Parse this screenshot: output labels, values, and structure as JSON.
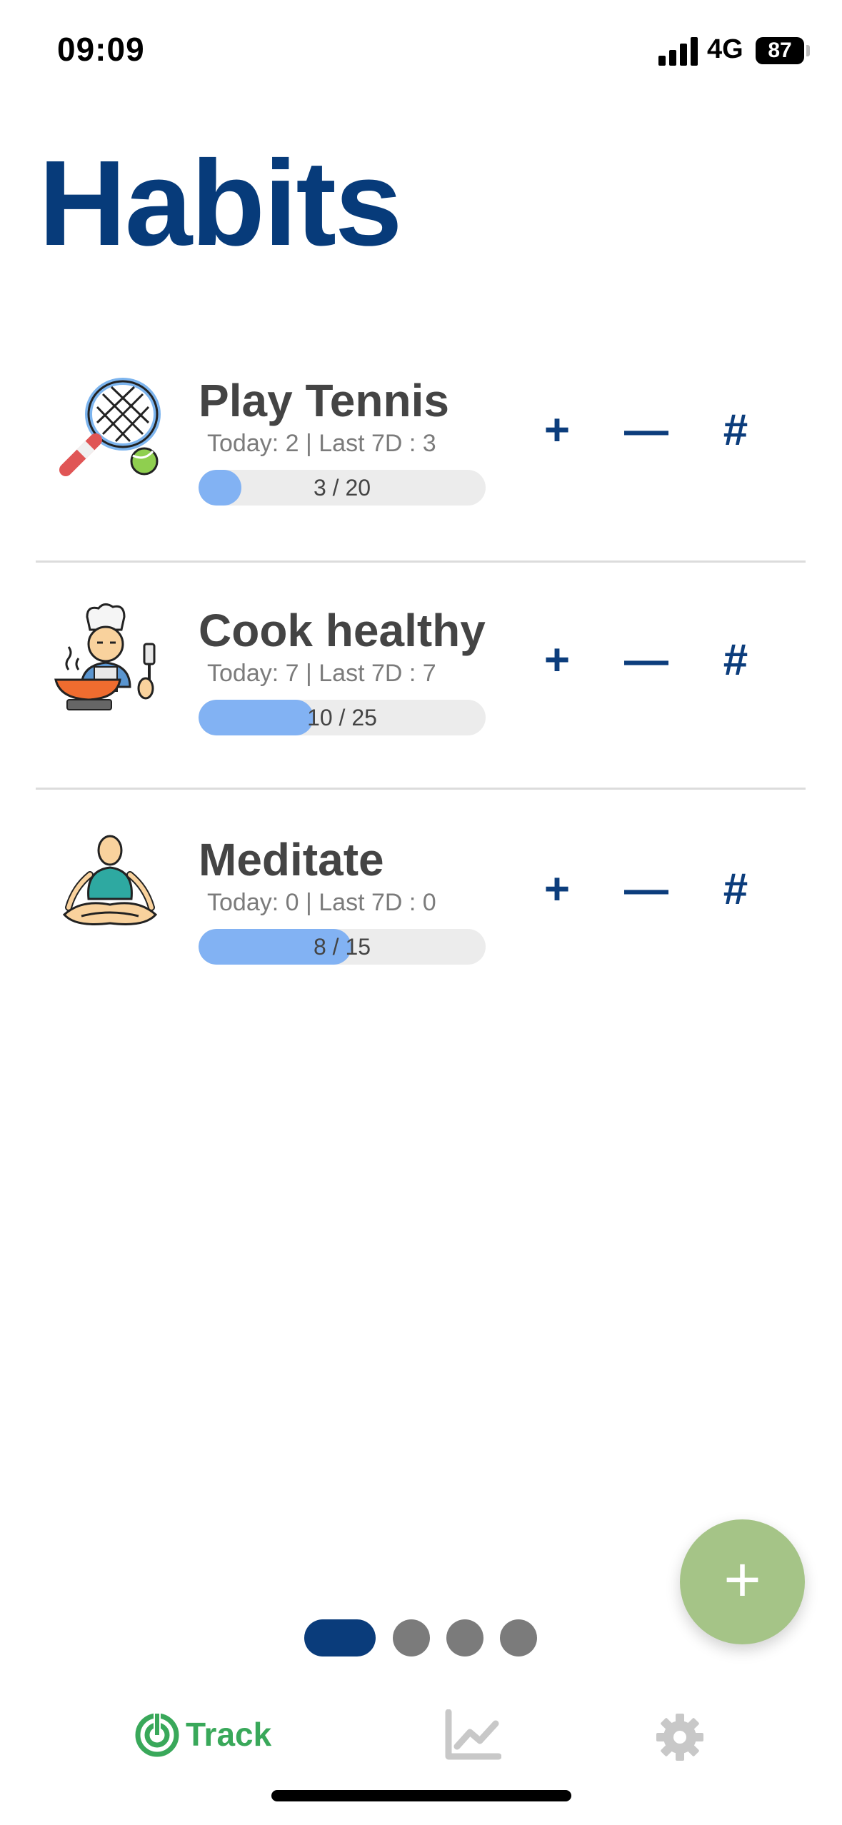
{
  "status": {
    "time": "09:09",
    "network": "4G",
    "battery": "87"
  },
  "page": {
    "title": "Habits"
  },
  "habits": [
    {
      "name": "Play Tennis",
      "stats": "Today: 2 | Last 7D : 3",
      "progress_label": "3 / 20",
      "progress": 0.15,
      "icon": "tennis-racket-icon"
    },
    {
      "name": "Cook healthy",
      "stats": "Today: 7 | Last 7D : 7",
      "progress_label": "10 / 25",
      "progress": 0.4,
      "icon": "chef-cooking-icon"
    },
    {
      "name": "Meditate",
      "stats": "Today: 0 | Last 7D : 0",
      "progress_label": "8 / 15",
      "progress": 0.533,
      "icon": "meditation-icon"
    }
  ],
  "actions": {
    "plus": "+",
    "minus": "—",
    "hash": "#"
  },
  "fab": {
    "label": "+"
  },
  "pager": {
    "count": 4,
    "active": 0
  },
  "tabbar": {
    "track_label": "Track",
    "active_color": "#39a85a",
    "inactive_color": "#c8c8c8"
  },
  "colors": {
    "title": "#073b7a",
    "accent": "#0c3d7c",
    "progress_fill": "#82b2f3",
    "fab": "#a5c487"
  }
}
